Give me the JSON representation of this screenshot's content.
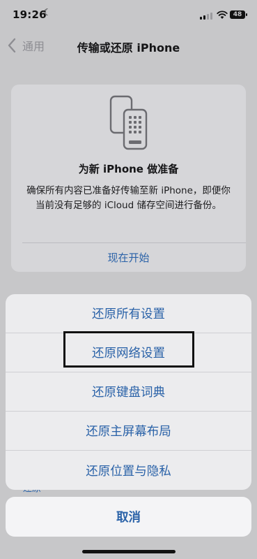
{
  "status_bar": {
    "time": "19:26",
    "battery": "48"
  },
  "nav": {
    "back_label": "通用",
    "title": "传输或还原 iPhone"
  },
  "card": {
    "title": "为新 iPhone 做准备",
    "description": "确保所有内容已准备好传输至新 iPhone，即便你当前没有足够的 iCloud 储存空间进行备份。",
    "action": "现在开始"
  },
  "peek_text": "还原",
  "action_sheet": {
    "items": [
      {
        "label": "还原所有设置"
      },
      {
        "label": "还原网络设置"
      },
      {
        "label": "还原键盘词典"
      },
      {
        "label": "还原主屏幕布局"
      },
      {
        "label": "还原位置与隐私"
      }
    ],
    "cancel": "取消"
  },
  "colors": {
    "accent": "#2a62a8",
    "dim_background": "#c7c7c9",
    "sheet_background": "#ececee",
    "highlight_border": "#111111"
  }
}
